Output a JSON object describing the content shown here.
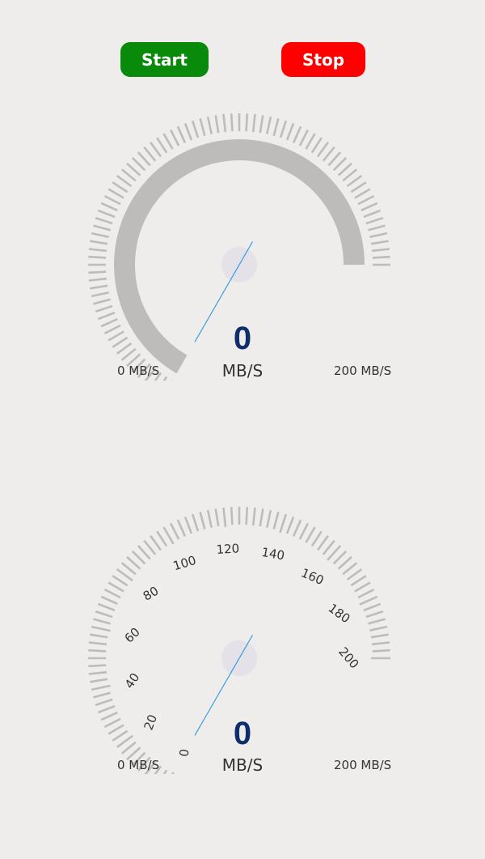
{
  "buttons": {
    "start_label": "Start",
    "stop_label": "Stop",
    "start_color": "#0a8a0a",
    "stop_color": "#ff0000"
  },
  "colors": {
    "track": "#bdbcbb",
    "tick": "#bdbcbb",
    "value_text": "#0d2d6b",
    "needle_outer": "#1e4a9c",
    "needle_inner": "#7a1a6e",
    "needle_edge": "#3aa0e0",
    "hub": "#e4e2e8"
  },
  "gauges": [
    {
      "name": "gauge-1",
      "style": "arc",
      "value": "0",
      "unit": "MB/S",
      "min_label": "0 MB/S",
      "max_label": "200 MB/S",
      "min": 0,
      "max": 200,
      "needle_value": 0,
      "scale_labels": []
    },
    {
      "name": "gauge-2",
      "style": "numbered",
      "value": "0",
      "unit": "MB/S",
      "min_label": "0 MB/S",
      "max_label": "200 MB/S",
      "min": 0,
      "max": 200,
      "needle_value": 0,
      "scale_labels": [
        "0",
        "20",
        "40",
        "60",
        "80",
        "100",
        "120",
        "140",
        "160",
        "180",
        "200"
      ]
    }
  ]
}
